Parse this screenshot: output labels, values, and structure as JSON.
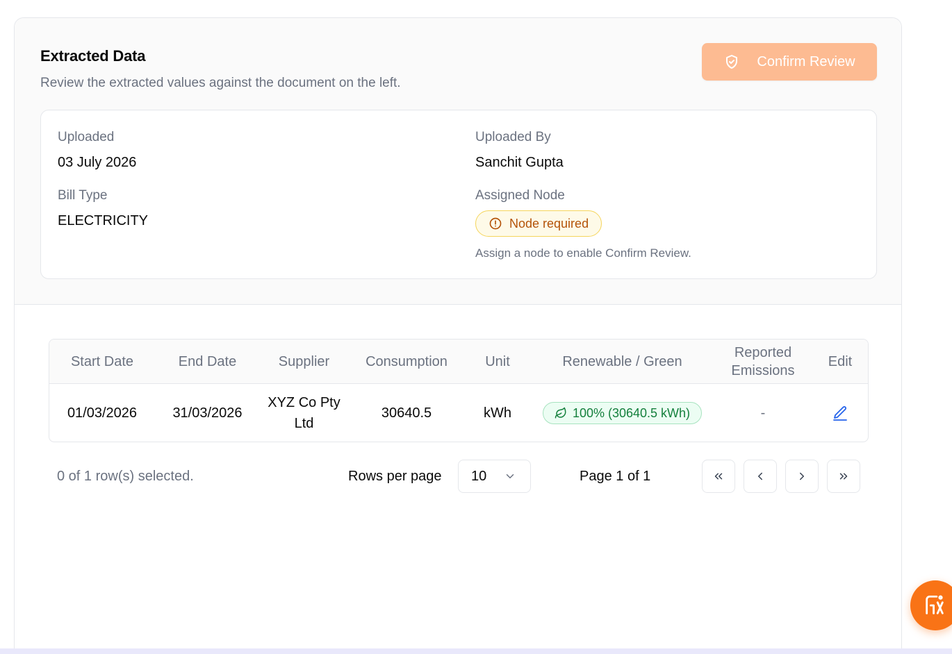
{
  "header": {
    "title": "Extracted Data",
    "subtitle": "Review the extracted values against the document on the left.",
    "confirm_button": "Confirm Review",
    "confirm_button_icon": "shield-check-icon"
  },
  "info": {
    "uploaded_label": "Uploaded",
    "uploaded_value": "03 July 2026",
    "uploaded_by_label": "Uploaded By",
    "uploaded_by_value": "Sanchit Gupta",
    "bill_type_label": "Bill Type",
    "bill_type_value": "ELECTRICITY",
    "assigned_node_label": "Assigned Node",
    "node_badge": "Node required",
    "node_badge_icon": "alert-circle-icon",
    "node_hint": "Assign a node to enable Confirm Review."
  },
  "table": {
    "columns": [
      "Start Date",
      "End Date",
      "Supplier",
      "Consumption",
      "Unit",
      "Renewable / Green",
      "Reported Emissions",
      "Edit"
    ],
    "rows": [
      {
        "start_date": "01/03/2026",
        "end_date": "31/03/2026",
        "supplier": "XYZ Co Pty Ltd",
        "consumption": "30640.5",
        "unit": "kWh",
        "renewable": "100% (30640.5 kWh)",
        "renewable_icon": "leaf-icon",
        "reported_emissions": "-",
        "edit_icon": "pencil-icon"
      }
    ]
  },
  "pagination": {
    "selected_text": "0 of 1 row(s) selected.",
    "rows_per_page_label": "Rows per page",
    "rows_per_page_value": "10",
    "page_text": "Page 1 of 1"
  },
  "colors": {
    "accent": "#f97316",
    "confirm_disabled": "#fdbb92",
    "warning": "#b45309",
    "success": "#15803d",
    "edit": "#2563eb"
  }
}
